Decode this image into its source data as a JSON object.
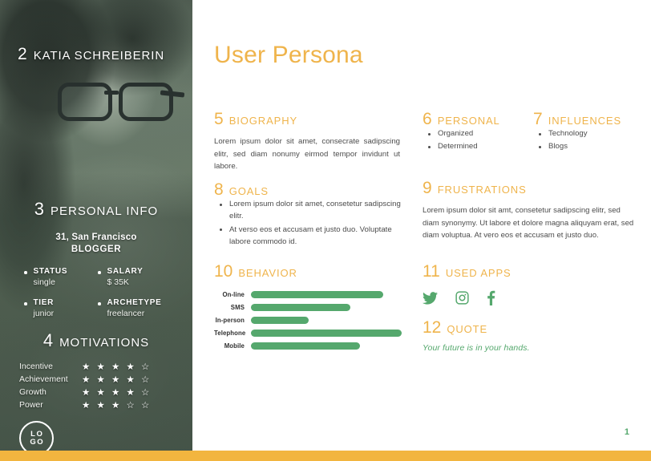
{
  "page": {
    "title": "User Persona",
    "page_number": "1",
    "accent_orange": "#efb44c",
    "accent_green": "#55a86d",
    "bottom_bar_color": "#f2b53f",
    "body_text_color": "#4c4c4c"
  },
  "persona": {
    "number": "2",
    "name": "KATIA SCHREIBERIN"
  },
  "logo": {
    "line1": "LO",
    "line2": "GO"
  },
  "personal_info": {
    "number": "3",
    "heading": "PERSONAL INFO",
    "age_location": "31, San Francisco",
    "role": "BLOGGER",
    "fields": [
      {
        "key": "STATUS",
        "value": "single"
      },
      {
        "key": "SALARY",
        "value": "$ 35K"
      },
      {
        "key": "TIER",
        "value": "junior"
      },
      {
        "key": "ARCHETYPE",
        "value": "freelancer"
      }
    ]
  },
  "motivations": {
    "number": "4",
    "heading": "MOTIVATIONS",
    "filled_star": "★",
    "empty_star": "☆",
    "items": [
      {
        "label": "Incentive",
        "rating": 4,
        "max": 5,
        "stars": "★ ★ ★ ★ ☆"
      },
      {
        "label": "Achievement",
        "rating": 4,
        "max": 5,
        "stars": "★ ★ ★ ★ ☆"
      },
      {
        "label": "Growth",
        "rating": 4,
        "max": 5,
        "stars": "★ ★ ★ ★ ☆"
      },
      {
        "label": "Power",
        "rating": 3,
        "max": 5,
        "stars": "★ ★ ★ ☆ ☆"
      }
    ]
  },
  "biography": {
    "number": "5",
    "heading": "BIOGRAPHY",
    "text": "Lorem ipsum dolor sit amet, consecrate sadipscing elitr, sed diam nonumy eirmod tempor invidunt ut labore."
  },
  "personal": {
    "number": "6",
    "heading": "PERSONAL",
    "items": [
      "Organized",
      "Determined"
    ]
  },
  "influences": {
    "number": "7",
    "heading": "INFLUENCES",
    "items": [
      "Technology",
      "Blogs"
    ]
  },
  "goals": {
    "number": "8",
    "heading": "GOALS",
    "items": [
      "Lorem ipsum dolor sit amet, consetetur sadipscing elitr.",
      "At verso eos et accusam et justo duo. Voluptate labore commodo id."
    ]
  },
  "frustrations": {
    "number": "9",
    "heading": "FRUSTRATIONS",
    "text": "Lorem ipsum dolor sit amt, consetetur sadipscing elitr, sed diam synonymy. Ut labore et dolore magna aliquyam erat, sed diam voluptua. At vero eos et accusam et justo duo."
  },
  "behavior": {
    "number": "10",
    "heading": "BEHAVIOR"
  },
  "used_apps": {
    "number": "11",
    "heading": "USED APPS",
    "icons": [
      "twitter-icon",
      "instagram-icon",
      "facebook-icon"
    ]
  },
  "quote": {
    "number": "12",
    "heading": "QUOTE",
    "text": "Your future is in your hands."
  },
  "chart_data": {
    "type": "bar",
    "title": "BEHAVIOR",
    "orientation": "horizontal",
    "categories": [
      "On-line",
      "SMS",
      "In-person",
      "Telephone",
      "Mobile"
    ],
    "values": [
      85,
      64,
      37,
      97,
      70
    ],
    "xlabel": "",
    "ylabel": "",
    "xlim": [
      0,
      100
    ],
    "grid": false,
    "legend": false,
    "bar_color": "#55a86d"
  }
}
